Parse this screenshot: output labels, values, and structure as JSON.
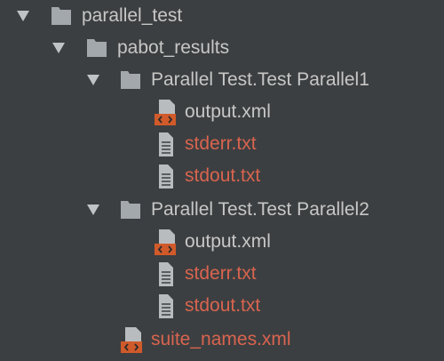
{
  "tree": {
    "root": {
      "label": "parallel_test",
      "icon": "folder-icon",
      "expanded": true
    },
    "pabot": {
      "label": "pabot_results",
      "icon": "folder-icon",
      "expanded": true
    },
    "suite1": {
      "label": "Parallel Test.Test Parallel1",
      "icon": "folder-icon",
      "expanded": true,
      "files": [
        {
          "label": "output.xml",
          "icon": "xml-file-icon",
          "color": "#c7c7c7"
        },
        {
          "label": "stderr.txt",
          "icon": "text-file-icon",
          "color": "#d9644f"
        },
        {
          "label": "stdout.txt",
          "icon": "text-file-icon",
          "color": "#d9644f"
        }
      ]
    },
    "suite2": {
      "label": "Parallel Test.Test Parallel2",
      "icon": "folder-icon",
      "expanded": true,
      "files": [
        {
          "label": "output.xml",
          "icon": "xml-file-icon",
          "color": "#c7c7c7"
        },
        {
          "label": "stderr.txt",
          "icon": "text-file-icon",
          "color": "#d9644f"
        },
        {
          "label": "stdout.txt",
          "icon": "text-file-icon",
          "color": "#d9644f"
        }
      ]
    },
    "suite_names": {
      "label": "suite_names.xml",
      "icon": "xml-file-icon",
      "color": "#d9644f"
    }
  },
  "colors": {
    "background": "#3c3f41",
    "folder": "#a3a8ad",
    "arrow": "#bfc3c6",
    "file_icon": "#b9bcbe",
    "xml_badge": "#d05a2a",
    "vcs_modified_red": "#d9644f"
  }
}
